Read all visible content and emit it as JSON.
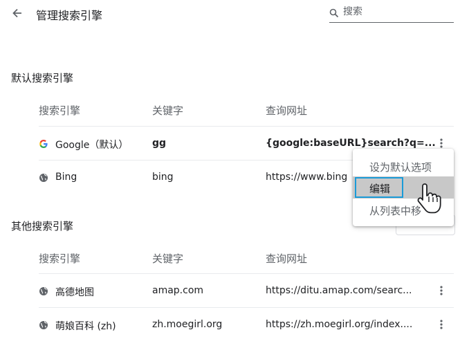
{
  "header": {
    "title": "管理搜索引擎",
    "search_placeholder": "搜索"
  },
  "default_section": {
    "title": "默认搜索引擎",
    "columns": [
      "搜索引擎",
      "关键字",
      "查询网址"
    ],
    "rows": [
      {
        "name": "Google（默认）",
        "keyword": "gg",
        "url": "{google:baseURL}search?q=..."
      },
      {
        "name": "Bing",
        "keyword": "bing",
        "url": "https://www.bing"
      }
    ]
  },
  "context_menu": {
    "items": [
      {
        "label": "设为默认选项"
      },
      {
        "label": "编辑"
      },
      {
        "label": "从列表中移"
      }
    ]
  },
  "other_section": {
    "title": "其他搜索引擎",
    "columns": [
      "搜索引擎",
      "关键字",
      "查询网址"
    ],
    "rows": [
      {
        "name": "高德地图",
        "keyword": "amap.com",
        "url": "https://ditu.amap.com/searc..."
      },
      {
        "name": "萌娘百科 (zh)",
        "keyword": "zh.moegirl.org",
        "url": "https://zh.moegirl.org/index...."
      }
    ]
  },
  "colors": {
    "accent": "#1a9bd8",
    "text": "#202124",
    "muted": "#5f6368",
    "divider": "#e8eaed",
    "menu_hover": "#c8c8c8"
  },
  "icons": [
    "back-arrow-icon",
    "search-icon",
    "google-g-icon",
    "globe-icon",
    "more-vert-icon",
    "hand-pointer-icon"
  ]
}
